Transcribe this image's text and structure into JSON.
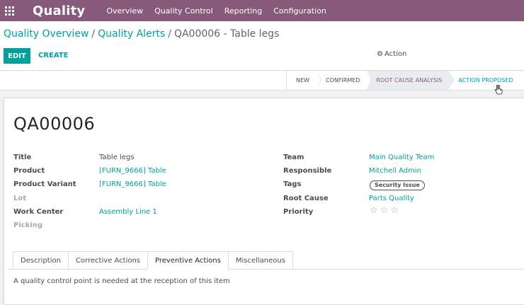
{
  "navbar": {
    "brand": "Quality",
    "menu": [
      "Overview",
      "Quality Control",
      "Reporting",
      "Configuration"
    ]
  },
  "breadcrumb": {
    "items": [
      "Quality Overview",
      "Quality Alerts"
    ],
    "current": "QA00006 - Table legs",
    "separator": "/"
  },
  "buttons": {
    "edit": "EDIT",
    "create": "CREATE",
    "action": "Action"
  },
  "stages": [
    "NEW",
    "CONFIRMED",
    "ROOT CAUSE ANALYSIS",
    "ACTION PROPOSED"
  ],
  "record": {
    "name": "QA00006",
    "left_fields": {
      "title_label": "Title",
      "title_value": "Table legs",
      "product_label": "Product",
      "product_value": "[FURN_9666] Table",
      "variant_label": "Product Variant",
      "variant_value": "[FURN_9666] Table",
      "lot_label": "Lot",
      "workcenter_label": "Work Center",
      "workcenter_value": "Assembly Line 1",
      "picking_label": "Picking"
    },
    "right_fields": {
      "team_label": "Team",
      "team_value": "Main Quality Team",
      "responsible_label": "Responsible",
      "responsible_value": "Mitchell Admin",
      "tags_label": "Tags",
      "tag_value": "Security Issue",
      "rootcause_label": "Root Cause",
      "rootcause_value": "Parts Quality",
      "priority_label": "Priority",
      "priority_stars": 3,
      "priority_filled": 0
    }
  },
  "tabs": {
    "items": [
      "Description",
      "Corrective Actions",
      "Preventive Actions",
      "Miscellaneous"
    ],
    "active": "Preventive Actions",
    "content": "A quality control point is needed at the reception of this item"
  },
  "colors": {
    "navbar": "#875a7b",
    "accent": "#00a09d"
  }
}
